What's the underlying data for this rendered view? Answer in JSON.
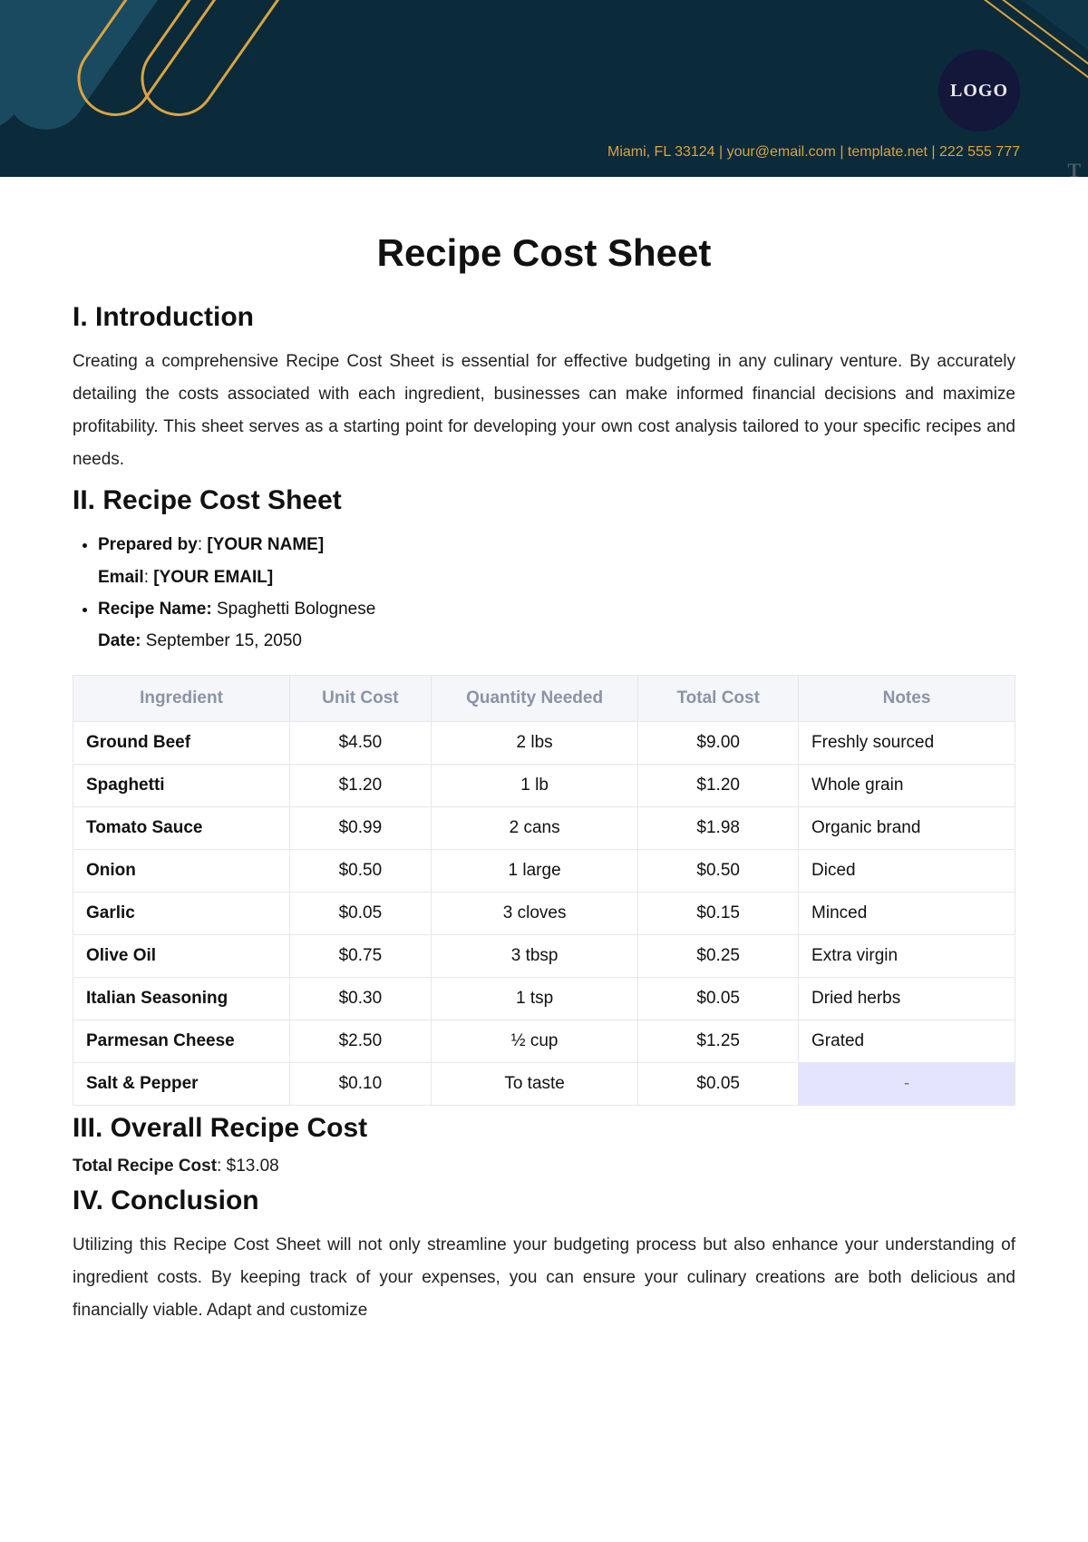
{
  "header": {
    "logo_text": "LOGO",
    "contact": "Miami, FL 33124 | your@email.com | template.net | 222 555 777",
    "corner_mark": "T"
  },
  "title": "Recipe Cost Sheet",
  "sections": {
    "intro_heading": "I. Introduction",
    "intro_body": "Creating a comprehensive Recipe Cost Sheet is essential for effective budgeting in any culinary venture. By accurately detailing the costs associated with each ingredient, businesses can make informed financial decisions and maximize profitability. This sheet serves as a starting point for developing your own cost analysis tailored to your specific recipes and needs.",
    "sheet_heading": "II. Recipe Cost Sheet",
    "overall_heading": "III. Overall Recipe Cost",
    "conclusion_heading": "IV. Conclusion",
    "conclusion_body": "Utilizing this Recipe Cost Sheet will not only streamline your budgeting process but also enhance your understanding of ingredient costs. By keeping track of your expenses, you can ensure your culinary creations are both delicious and financially viable. Adapt and customize"
  },
  "meta": {
    "prepared_by_label": "Prepared by",
    "prepared_by_value": "[YOUR NAME]",
    "email_label": "Email",
    "email_value": "[YOUR EMAIL]",
    "recipe_name_label": "Recipe Name:",
    "recipe_name_value": "Spaghetti Bolognese",
    "date_label": "Date:",
    "date_value": "September 15, 2050"
  },
  "table": {
    "headers": {
      "ingredient": "Ingredient",
      "unit_cost": "Unit Cost",
      "quantity": "Quantity Needed",
      "total_cost": "Total Cost",
      "notes": "Notes"
    },
    "rows": [
      {
        "ingredient": "Ground Beef",
        "unit_cost": "$4.50",
        "quantity": "2 lbs",
        "total_cost": "$9.00",
        "notes": "Freshly sourced"
      },
      {
        "ingredient": "Spaghetti",
        "unit_cost": "$1.20",
        "quantity": "1 lb",
        "total_cost": "$1.20",
        "notes": "Whole grain"
      },
      {
        "ingredient": "Tomato Sauce",
        "unit_cost": "$0.99",
        "quantity": "2 cans",
        "total_cost": "$1.98",
        "notes": "Organic brand"
      },
      {
        "ingredient": "Onion",
        "unit_cost": "$0.50",
        "quantity": "1 large",
        "total_cost": "$0.50",
        "notes": "Diced"
      },
      {
        "ingredient": "Garlic",
        "unit_cost": "$0.05",
        "quantity": "3 cloves",
        "total_cost": "$0.15",
        "notes": "Minced"
      },
      {
        "ingredient": "Olive Oil",
        "unit_cost": "$0.75",
        "quantity": "3 tbsp",
        "total_cost": "$0.25",
        "notes": "Extra virgin"
      },
      {
        "ingredient": "Italian Seasoning",
        "unit_cost": "$0.30",
        "quantity": "1 tsp",
        "total_cost": "$0.05",
        "notes": "Dried herbs"
      },
      {
        "ingredient": "Parmesan Cheese",
        "unit_cost": "$2.50",
        "quantity": "½ cup",
        "total_cost": "$1.25",
        "notes": "Grated"
      },
      {
        "ingredient": "Salt & Pepper",
        "unit_cost": "$0.10",
        "quantity": "To taste",
        "total_cost": "$0.05",
        "notes": "-"
      }
    ]
  },
  "total": {
    "label": "Total Recipe Cost",
    "value": "$13.08"
  }
}
